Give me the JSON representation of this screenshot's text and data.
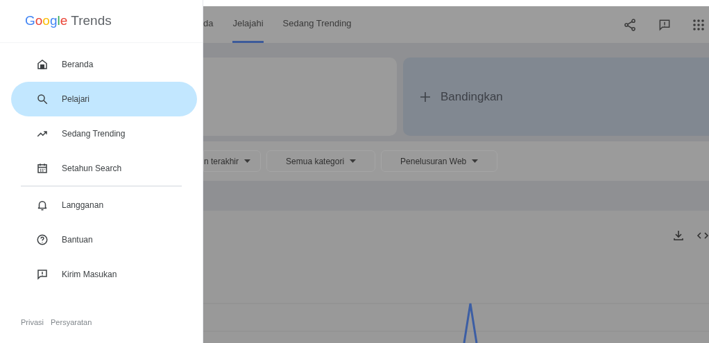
{
  "sidebar": {
    "logo": {
      "brand": "Google",
      "product": "Trends"
    },
    "groups": [
      [
        {
          "label": "Beranda",
          "kind": "home",
          "selected": false
        },
        {
          "label": "Pelajari",
          "kind": "search",
          "selected": true
        },
        {
          "label": "Sedang Trending",
          "kind": "trending",
          "selected": false
        },
        {
          "label": "Setahun Search",
          "kind": "calendar",
          "selected": false
        }
      ],
      [
        {
          "label": "Langganan",
          "kind": "bell",
          "selected": false
        },
        {
          "label": "Bantuan",
          "kind": "help",
          "selected": false
        },
        {
          "label": "Kirim Masukan",
          "kind": "feedback",
          "selected": false
        }
      ]
    ],
    "footer_links": [
      "Privasi",
      "Persyaratan"
    ]
  },
  "header": {
    "tabs": [
      {
        "label": "da",
        "selected": false
      },
      {
        "label": "Jelajahi",
        "selected": true
      },
      {
        "label": "Sedang Trending",
        "selected": false
      }
    ]
  },
  "compare": {
    "label": "Bandingkan"
  },
  "filters": [
    "n terakhir",
    "Semua kategori",
    "Penelusuran Web"
  ]
}
